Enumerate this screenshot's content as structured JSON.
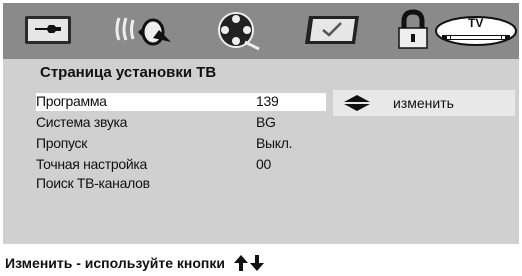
{
  "iconbar": {
    "icons": [
      "tools-icon",
      "audio-speaker-icon",
      "film-reel-icon",
      "checked-screen-icon",
      "padlock-icon",
      "tv-icon"
    ],
    "tv_label": "TV"
  },
  "page": {
    "title": "Страница установки ТВ"
  },
  "settings": [
    {
      "label": "Программа",
      "value": "139"
    },
    {
      "label": "Система звука",
      "value": "BG"
    },
    {
      "label": "Пропуск",
      "value": "Выкл."
    },
    {
      "label": "Точная настройка",
      "value": "00"
    },
    {
      "label": "Поиск ТВ-каналов",
      "value": ""
    }
  ],
  "action": {
    "label": "изменить",
    "icon": "up-down-arrows-icon"
  },
  "footer": {
    "hint": "Изменить - используйте кнопки",
    "icons": [
      "arrow-up-icon",
      "arrow-down-icon"
    ]
  }
}
